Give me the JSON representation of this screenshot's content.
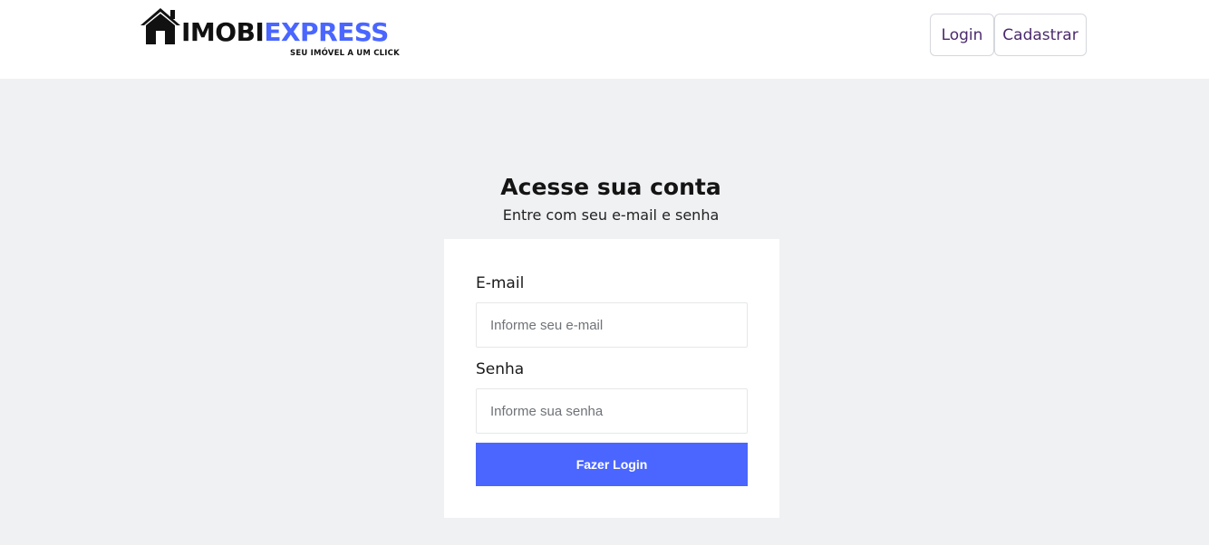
{
  "brand": {
    "word_dark": "IMOBI",
    "word_accent": "EXPRESS",
    "tagline": "SEU IMÓVEL A UM  CLICK",
    "icon": "house-icon",
    "accent_color": "#4a66ff"
  },
  "nav": {
    "login_label": "Login",
    "signup_label": "Cadastrar"
  },
  "main": {
    "title": "Acesse sua conta",
    "subtitle": "Entre com seu e-mail e senha"
  },
  "form": {
    "email_label": "E-mail",
    "email_placeholder": "Informe seu e-mail",
    "email_value": "",
    "password_label": "Senha",
    "password_placeholder": "Informe sua senha",
    "password_value": "",
    "submit_label": "Fazer Login"
  }
}
